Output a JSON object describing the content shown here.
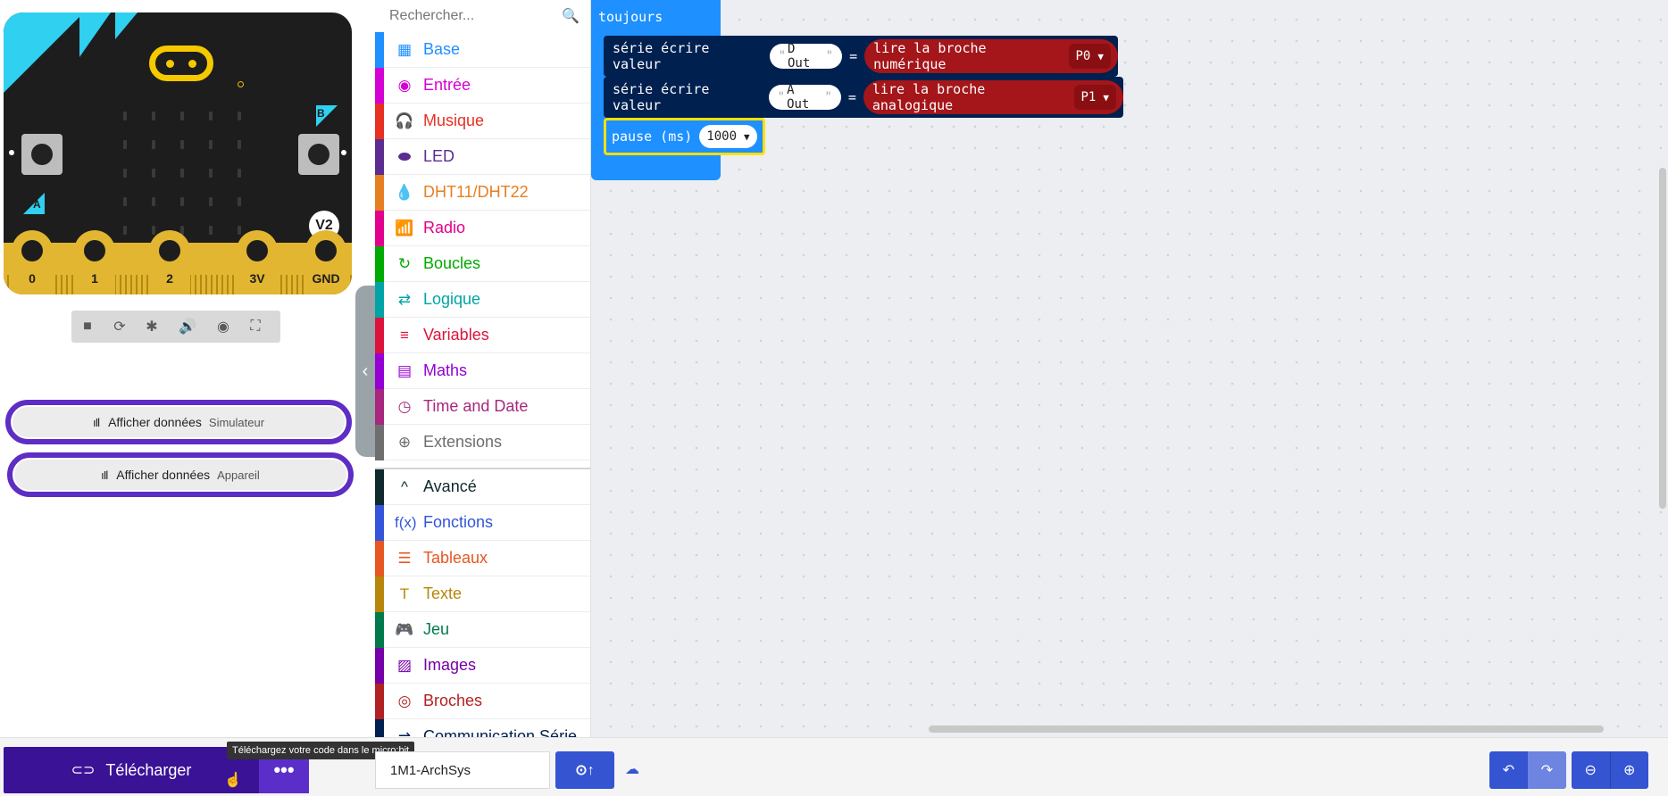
{
  "simulator": {
    "pins": [
      "0",
      "1",
      "2",
      "3V",
      "GND"
    ],
    "button_a": "A",
    "button_b": "B",
    "version_badge": "V2",
    "toolbar": [
      "stop-icon",
      "restart-icon",
      "debug-icon",
      "sound-icon",
      "screenshot-icon",
      "fullscreen-icon"
    ],
    "data_buttons": [
      {
        "label": "Afficher données",
        "sub": "Simulateur"
      },
      {
        "label": "Afficher données",
        "sub": "Appareil"
      }
    ]
  },
  "toolbox": {
    "search_placeholder": "Rechercher...",
    "categories": [
      {
        "label": "Base",
        "color": "#1e90ff",
        "icon": "grid-icon",
        "glyph": "▦"
      },
      {
        "label": "Entrée",
        "color": "#d400d4",
        "icon": "target-icon",
        "glyph": "◉"
      },
      {
        "label": "Musique",
        "color": "#e63022",
        "icon": "headphones-icon",
        "glyph": "🎧"
      },
      {
        "label": "LED",
        "color": "#5c2d91",
        "icon": "toggle-icon",
        "glyph": "⬬"
      },
      {
        "label": "DHT11/DHT22",
        "color": "#e67e22",
        "icon": "drop-icon",
        "glyph": "💧"
      },
      {
        "label": "Radio",
        "color": "#e3008c",
        "icon": "signal-icon",
        "glyph": "📶"
      },
      {
        "label": "Boucles",
        "color": "#00aa00",
        "icon": "loop-icon",
        "glyph": "↻"
      },
      {
        "label": "Logique",
        "color": "#00a4a6",
        "icon": "shuffle-icon",
        "glyph": "⇄"
      },
      {
        "label": "Variables",
        "color": "#dc143c",
        "icon": "list-icon",
        "glyph": "≡"
      },
      {
        "label": "Maths",
        "color": "#9400d3",
        "icon": "calculator-icon",
        "glyph": "▤"
      },
      {
        "label": "Time and Date",
        "color": "#a8267d",
        "icon": "clock-icon",
        "glyph": "◷"
      },
      {
        "label": "Extensions",
        "color": "#6e6e6e",
        "icon": "plus-circle-icon",
        "glyph": "⊕"
      }
    ],
    "advanced": [
      {
        "label": "Avancé",
        "color": "#102a2e",
        "icon": "chevron-up-icon",
        "glyph": "^"
      },
      {
        "label": "Fonctions",
        "color": "#3455db",
        "icon": "function-icon",
        "glyph": "f(x)"
      },
      {
        "label": "Tableaux",
        "color": "#e65722",
        "icon": "list-icon",
        "glyph": "☰"
      },
      {
        "label": "Texte",
        "color": "#b8860b",
        "icon": "text-icon",
        "glyph": "T"
      },
      {
        "label": "Jeu",
        "color": "#007a4b",
        "icon": "gamepad-icon",
        "glyph": "🎮"
      },
      {
        "label": "Images",
        "color": "#7600a8",
        "icon": "image-icon",
        "glyph": "▨"
      },
      {
        "label": "Broches",
        "color": "#b22222",
        "icon": "pin-icon",
        "glyph": "◎"
      },
      {
        "label": "Communication Série",
        "color": "#002050",
        "icon": "serial-icon",
        "glyph": "⇌"
      }
    ]
  },
  "workspace": {
    "hat_label": "toujours",
    "statements": [
      {
        "prefix": "série écrire valeur",
        "name": "D Out",
        "eq": "=",
        "reporter": "lire la broche numérique",
        "pin": "P0"
      },
      {
        "prefix": "série écrire valeur",
        "name": "A Out",
        "eq": "=",
        "reporter": "lire la broche analogique",
        "pin": "P1"
      }
    ],
    "pause": {
      "label": "pause (ms)",
      "value": "1000"
    }
  },
  "bottom": {
    "download_label": "Télécharger",
    "tooltip": "Téléchargez votre code dans le micro:bit",
    "project_name": "1M1-ArchSys"
  }
}
